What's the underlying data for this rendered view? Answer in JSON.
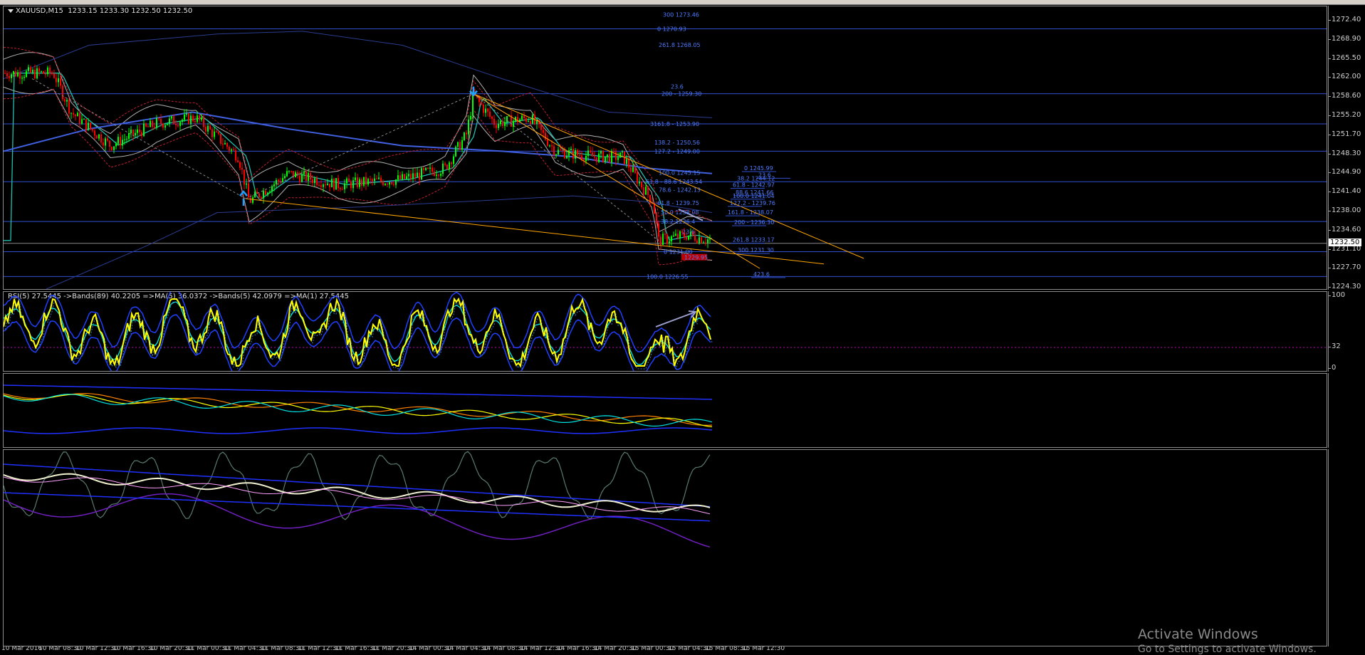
{
  "chart": {
    "symbol_label": "XAUUSD,M15",
    "ohlc": "1233.15 1233.30 1232.50 1232.50",
    "last_price": "1232.50",
    "price_ticks": [
      "1272.40",
      "1268.90",
      "1265.50",
      "1262.00",
      "1258.60",
      "1255.20",
      "1251.70",
      "1248.30",
      "1244.90",
      "1241.40",
      "1238.00",
      "1234.60",
      "1231.10",
      "1227.70",
      "1224.30"
    ],
    "fib_labels": [
      "300 1273.46",
      "0 1270.93",
      "261.8 1268.05",
      "23.6",
      "200 - 1259.30",
      "3161.8 - 1253.90",
      "138.2 - 1250.56",
      "127.2 - 1249.00",
      "100.0 1245.15",
      "61.8 - 88.6 1243.54",
      "78.6 - 1242.13",
      "61.8 - 1239.75",
      "50.0 1238.08",
      "38.2 1236.4",
      "23.6",
      "0 1231.00",
      "100.0 1226.55",
      "1229.95"
    ],
    "fib_right_labels": [
      "0 1245.99",
      "23.6",
      "38.2 1244.12",
      "61.8 - 1242.97",
      "88.6 1241.66",
      "100.0 1241.04",
      "127.2 - 1239.76",
      "161.8 - 1238.07",
      "200 - 1236.30",
      "261.8 1233.17",
      "300 1231.30",
      "423.6"
    ]
  },
  "rsi_panel": {
    "header": "RSI(5) 27.5445  ->Bands(89) 40.2205  =>MA(5) 36.0372  ->Bands(5) 42.0979  =>MA(1) 27.5445",
    "scale_top": "100",
    "scale_mid": "32",
    "scale_bottom": "0"
  },
  "time_axis": [
    "10 Mar 2016",
    "10 Mar 08:30",
    "10 Mar 12:30",
    "10 Mar 16:30",
    "10 Mar 20:30",
    "11 Mar 00:30",
    "11 Mar 04:30",
    "11 Mar 08:30",
    "11 Mar 12:30",
    "11 Mar 16:30",
    "11 Mar 20:30",
    "14 Mar 00:30",
    "14 Mar 04:30",
    "14 Mar 08:30",
    "14 Mar 12:30",
    "14 Mar 16:30",
    "14 Mar 20:30",
    "15 Mar 00:30",
    "15 Mar 04:30",
    "15 Mar 08:30",
    "15 Mar 12:30"
  ],
  "watermark": {
    "title": "Activate Windows",
    "subtitle": "Go to Settings to activate Windows."
  },
  "colors": {
    "up_candle": "#00ff00",
    "down_candle": "#ff0000",
    "fib_line": "#2f4fd0",
    "trend_line": "#ffa500",
    "rsi_line": "#ffff00",
    "ma_line": "#00e0e0",
    "histogram_up": "#00aa00",
    "histogram_down": "#b000b0"
  }
}
